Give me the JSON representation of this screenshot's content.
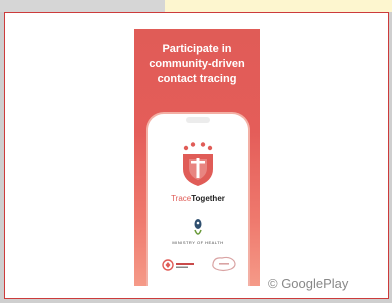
{
  "banner": {
    "headline_lines": [
      "Participate in",
      "community-driven",
      "contact tracing"
    ],
    "brand_part1": "Trace",
    "brand_part2": "Together",
    "ministry_text": "MINISTRY OF HEALTH"
  },
  "watermark": "© GooglePlay",
  "colors": {
    "banner_top": "#e05c57",
    "banner_bottom": "#f59a88",
    "brand_red": "#e05c57",
    "border": "#cc3b3b"
  },
  "icons": [
    "tracetogether-shield-logo",
    "ministry-of-health-logo",
    "partner-logo",
    "partner-logo"
  ]
}
